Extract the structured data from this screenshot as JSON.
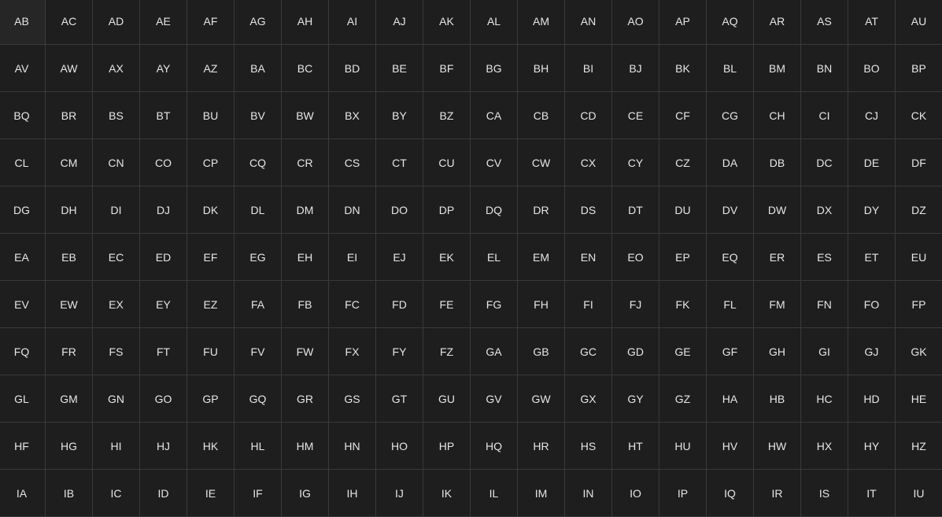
{
  "grid": {
    "cells": [
      "AB",
      "AC",
      "AD",
      "AE",
      "AF",
      "AG",
      "AH",
      "AI",
      "AJ",
      "AK",
      "AL",
      "AM",
      "AN",
      "AO",
      "AP",
      "AQ",
      "AR",
      "AS",
      "AT",
      "AU",
      "AV",
      "AW",
      "AX",
      "AY",
      "AZ",
      "BA",
      "BC",
      "BD",
      "BE",
      "BF",
      "BG",
      "BH",
      "BI",
      "BJ",
      "BK",
      "BL",
      "BM",
      "BN",
      "BO",
      "BP",
      "BQ",
      "BR",
      "BS",
      "BT",
      "BU",
      "BV",
      "BW",
      "BX",
      "BY",
      "BZ",
      "CA",
      "CB",
      "CD",
      "CE",
      "CF",
      "CG",
      "CH",
      "CI",
      "CJ",
      "CK",
      "CL",
      "CM",
      "CN",
      "CO",
      "CP",
      "CQ",
      "CR",
      "CS",
      "CT",
      "CU",
      "CV",
      "CW",
      "CX",
      "CY",
      "CZ",
      "DA",
      "DB",
      "DC",
      "DE",
      "DF",
      "DG",
      "DH",
      "DI",
      "DJ",
      "DK",
      "DL",
      "DM",
      "DN",
      "DO",
      "DP",
      "DQ",
      "DR",
      "DS",
      "DT",
      "DU",
      "DV",
      "DW",
      "DX",
      "DY",
      "DZ",
      "EA",
      "EB",
      "EC",
      "ED",
      "EF",
      "EG",
      "EH",
      "EI",
      "EJ",
      "EK",
      "EL",
      "EM",
      "EN",
      "EO",
      "EP",
      "EQ",
      "ER",
      "ES",
      "ET",
      "EU",
      "EV",
      "EW",
      "EX",
      "EY",
      "EZ",
      "FA",
      "FB",
      "FC",
      "FD",
      "FE",
      "FG",
      "FH",
      "FI",
      "FJ",
      "FK",
      "FL",
      "FM",
      "FN",
      "FO",
      "FP",
      "FQ",
      "FR",
      "FS",
      "FT",
      "FU",
      "FV",
      "FW",
      "FX",
      "FY",
      "FZ",
      "GA",
      "GB",
      "GC",
      "GD",
      "GE",
      "GF",
      "GH",
      "GI",
      "GJ",
      "GK",
      "GL",
      "GM",
      "GN",
      "GO",
      "GP",
      "GQ",
      "GR",
      "GS",
      "GT",
      "GU",
      "GV",
      "GW",
      "GX",
      "GY",
      "GZ",
      "HA",
      "HB",
      "HC",
      "HD",
      "HE",
      "HF",
      "HG",
      "HI",
      "HJ",
      "HK",
      "HL",
      "HM",
      "HN",
      "HO",
      "HP",
      "HQ",
      "HR",
      "HS",
      "HT",
      "HU",
      "HV",
      "HW",
      "HX",
      "HY",
      "HZ",
      "IA",
      "IB",
      "IC",
      "ID",
      "IE",
      "IF",
      "IG",
      "IH",
      "IJ",
      "IK",
      "IL",
      "IM",
      "IN",
      "IO",
      "IP",
      "IQ",
      "IR",
      "IS",
      "IT",
      "IU"
    ]
  }
}
